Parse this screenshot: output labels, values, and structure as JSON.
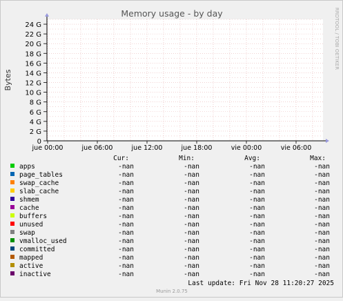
{
  "chart_data": {
    "type": "area",
    "title": "Memory usage - by day",
    "ylabel": "Bytes",
    "xlabel": "",
    "ylim": [
      0,
      25
    ],
    "yunit": "G",
    "yticks": [
      "0",
      "2 G",
      "4 G",
      "6 G",
      "8 G",
      "10 G",
      "12 G",
      "14 G",
      "16 G",
      "18 G",
      "20 G",
      "22 G",
      "24 G"
    ],
    "xticks": [
      "jue 00:00",
      "jue 06:00",
      "jue 12:00",
      "jue 18:00",
      "vie 00:00",
      "vie 06:00"
    ],
    "grid": true,
    "series": [
      {
        "name": "apps",
        "color": "#00cc00",
        "cur": "-nan",
        "min": "-nan",
        "avg": "-nan",
        "max": "-nan",
        "values": []
      },
      {
        "name": "page_tables",
        "color": "#0066b3",
        "cur": "-nan",
        "min": "-nan",
        "avg": "-nan",
        "max": "-nan",
        "values": []
      },
      {
        "name": "swap_cache",
        "color": "#ff8000",
        "cur": "-nan",
        "min": "-nan",
        "avg": "-nan",
        "max": "-nan",
        "values": []
      },
      {
        "name": "slab_cache",
        "color": "#ffcc00",
        "cur": "-nan",
        "min": "-nan",
        "avg": "-nan",
        "max": "-nan",
        "values": []
      },
      {
        "name": "shmem",
        "color": "#330099",
        "cur": "-nan",
        "min": "-nan",
        "avg": "-nan",
        "max": "-nan",
        "values": []
      },
      {
        "name": "cache",
        "color": "#990099",
        "cur": "-nan",
        "min": "-nan",
        "avg": "-nan",
        "max": "-nan",
        "values": []
      },
      {
        "name": "buffers",
        "color": "#ccff00",
        "cur": "-nan",
        "min": "-nan",
        "avg": "-nan",
        "max": "-nan",
        "values": []
      },
      {
        "name": "unused",
        "color": "#ff0000",
        "cur": "-nan",
        "min": "-nan",
        "avg": "-nan",
        "max": "-nan",
        "values": []
      },
      {
        "name": "swap",
        "color": "#808080",
        "cur": "-nan",
        "min": "-nan",
        "avg": "-nan",
        "max": "-nan",
        "values": []
      },
      {
        "name": "vmalloc_used",
        "color": "#008f00",
        "cur": "-nan",
        "min": "-nan",
        "avg": "-nan",
        "max": "-nan",
        "values": []
      },
      {
        "name": "committed",
        "color": "#00487d",
        "cur": "-nan",
        "min": "-nan",
        "avg": "-nan",
        "max": "-nan",
        "values": []
      },
      {
        "name": "mapped",
        "color": "#b35a00",
        "cur": "-nan",
        "min": "-nan",
        "avg": "-nan",
        "max": "-nan",
        "values": []
      },
      {
        "name": "active",
        "color": "#b38f00",
        "cur": "-nan",
        "min": "-nan",
        "avg": "-nan",
        "max": "-nan",
        "values": []
      },
      {
        "name": "inactive",
        "color": "#6b006b",
        "cur": "-nan",
        "min": "-nan",
        "avg": "-nan",
        "max": "-nan",
        "values": []
      }
    ]
  },
  "legend_headers": {
    "cur": "Cur:",
    "min": "Min:",
    "avg": "Avg:",
    "max": "Max:"
  },
  "watermark": "RRDTOOL / TOBI OETIKER",
  "last_update": "Last update: Fri Nov 28 11:20:27 2025",
  "footer": "Munin 2.0.75",
  "colors": {
    "background": "#f0f0f0",
    "plot_bg": "#ffffff",
    "major_grid": "#e8b4b4",
    "minor_grid": "#dcdcdc",
    "axis": "#000000",
    "title_text": "#555555",
    "text": "#000000",
    "footer_text": "#999999"
  }
}
